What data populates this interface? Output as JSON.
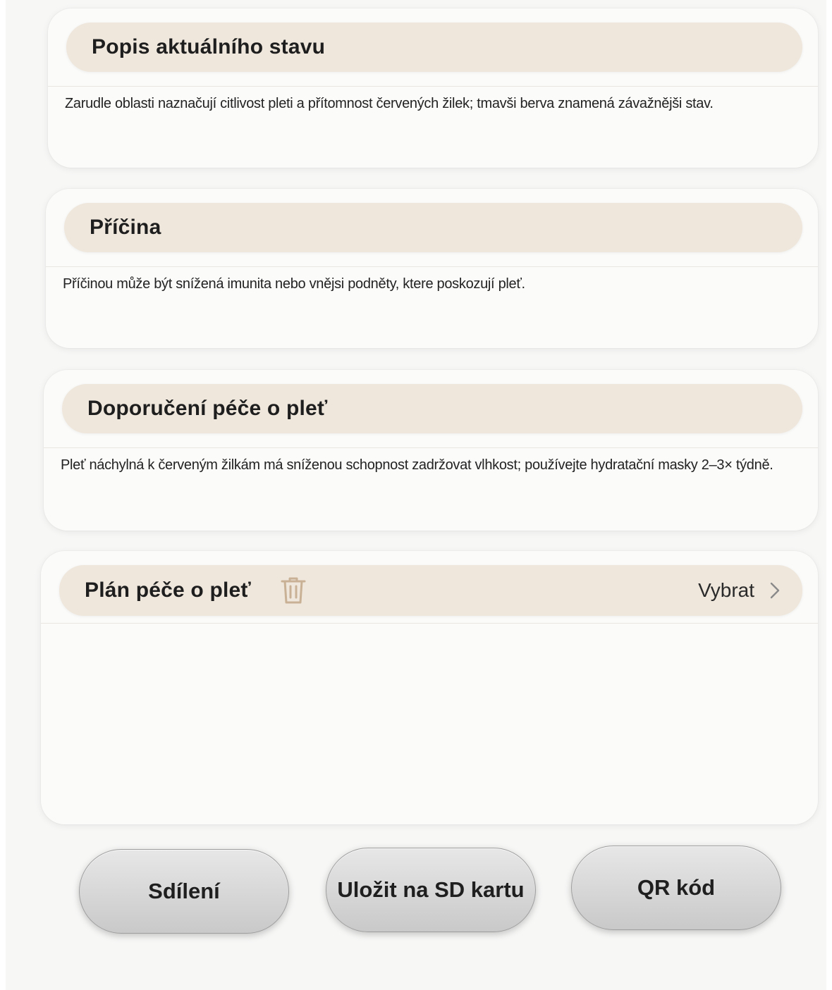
{
  "sections": [
    {
      "title": "Popis aktuálního stavu",
      "text": "Zarudle oblasti naznačují citlivost pleti a přítomnost červených žilek; tmavši berva znamená závažnějši stav."
    },
    {
      "title": "Příčina",
      "text": "Příčinou může být snížená imunita nebo vnějsi podněty, ktere poskozují pleť."
    },
    {
      "title": "Doporučení péče o pleť",
      "text": "Pleť náchylná k červeným žilkám má sníženou schopnost zadržovat vlhkost; používejte hydratační masky 2–3× týdně."
    }
  ],
  "plan": {
    "title": "Plán péče o pleť",
    "select_label": "Vybrat",
    "trash_icon": "trash-icon",
    "chevron_icon": "chevron-right-icon"
  },
  "buttons": {
    "share": "Sdílení",
    "save_sd": "Uložit na SD kartu",
    "qr": "QR kód"
  },
  "colors": {
    "header_bg": "#efe7dc",
    "trash_icon": "#c9b196",
    "button_gradient_top": "#e7e7e7",
    "button_gradient_bottom": "#c9c9c9"
  }
}
